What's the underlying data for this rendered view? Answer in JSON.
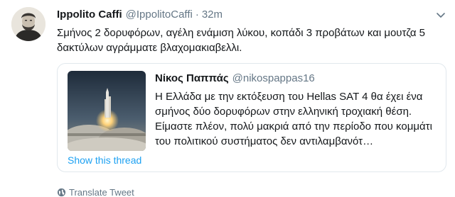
{
  "tweet": {
    "author_name": "Ippolito Caffi",
    "author_handle": "@IppolitoCaffi",
    "separator": "·",
    "timestamp": "32m",
    "text": "Σμήνος 2 δορυφόρων, αγέλη ενάμιση λύκου, κοπάδι 3 προβάτων και μουτζα 5 δακτύλων αγράμματε βλαχομακιαβελλι.",
    "avatar_icon": "portrait-avatar-icon",
    "menu_icon": "chevron-down-icon"
  },
  "quoted_tweet": {
    "author_name": "Νίκος Παππάς",
    "author_handle": "@nikospappas16",
    "text": "Η Ελλάδα με την εκτόξευση του Hellas SAT 4 θα έχει ένα σμήνος δύο δορυφόρων στην ελληνική τροχιακή θέση. Είμαστε πλέον, πολύ μακριά από την περίοδο που κομμάτι του πολιτικού συστήματος δεν αντιλαμβανότ…",
    "show_thread_label": "Show this thread",
    "thumbnail_icon": "rocket-launch-image"
  },
  "translate": {
    "label": "Translate Tweet",
    "icon": "globe-icon"
  },
  "colors": {
    "text_primary": "#14171a",
    "text_secondary": "#657786",
    "link_blue": "#1da1f2",
    "border": "#e1e8ed"
  }
}
